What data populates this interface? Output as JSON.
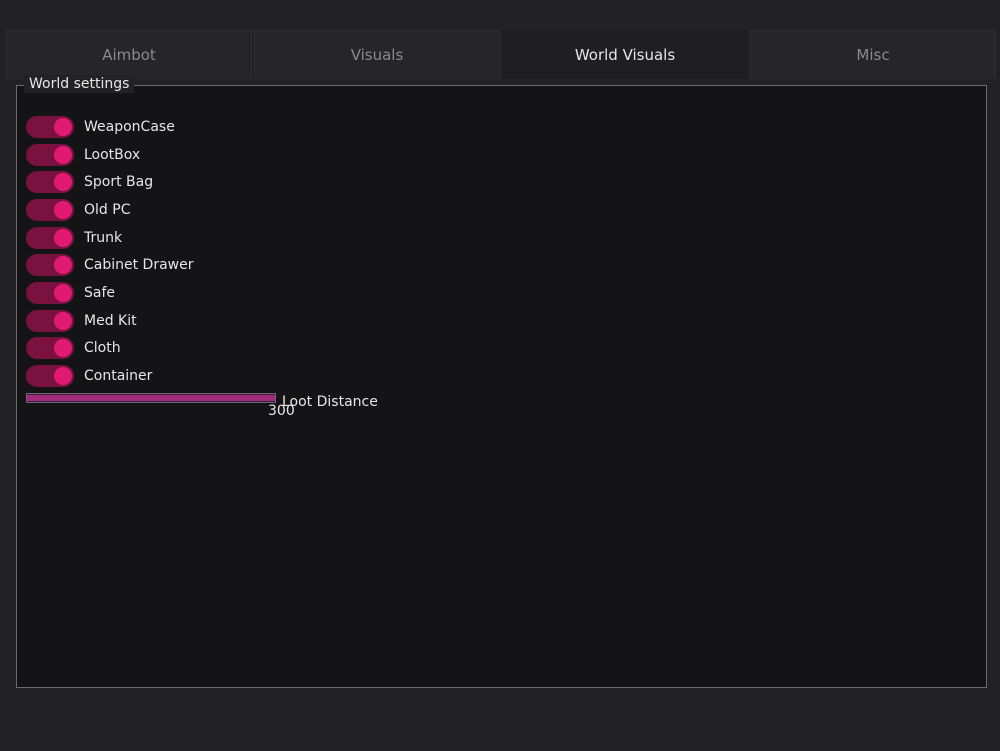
{
  "tabs": [
    {
      "label": "Aimbot",
      "active": false
    },
    {
      "label": "Visuals",
      "active": false
    },
    {
      "label": "World Visuals",
      "active": true
    },
    {
      "label": "Misc",
      "active": false
    }
  ],
  "world_settings": {
    "title": "World settings",
    "toggles": [
      {
        "label": "WeaponCase",
        "on": true
      },
      {
        "label": "LootBox",
        "on": true
      },
      {
        "label": "Sport Bag",
        "on": true
      },
      {
        "label": "Old PC",
        "on": true
      },
      {
        "label": "Trunk",
        "on": true
      },
      {
        "label": "Cabinet Drawer",
        "on": true
      },
      {
        "label": "Safe",
        "on": true
      },
      {
        "label": "Med Kit",
        "on": true
      },
      {
        "label": "Cloth",
        "on": true
      },
      {
        "label": "Container",
        "on": true
      }
    ],
    "loot_distance": {
      "label": "Loot Distance",
      "value": "300",
      "fill_fraction": 1.0
    }
  },
  "colors": {
    "accent": "#e01a72",
    "accent_dark": "#7a1240",
    "panel_bg": "#141416",
    "window_bg": "#222224"
  }
}
